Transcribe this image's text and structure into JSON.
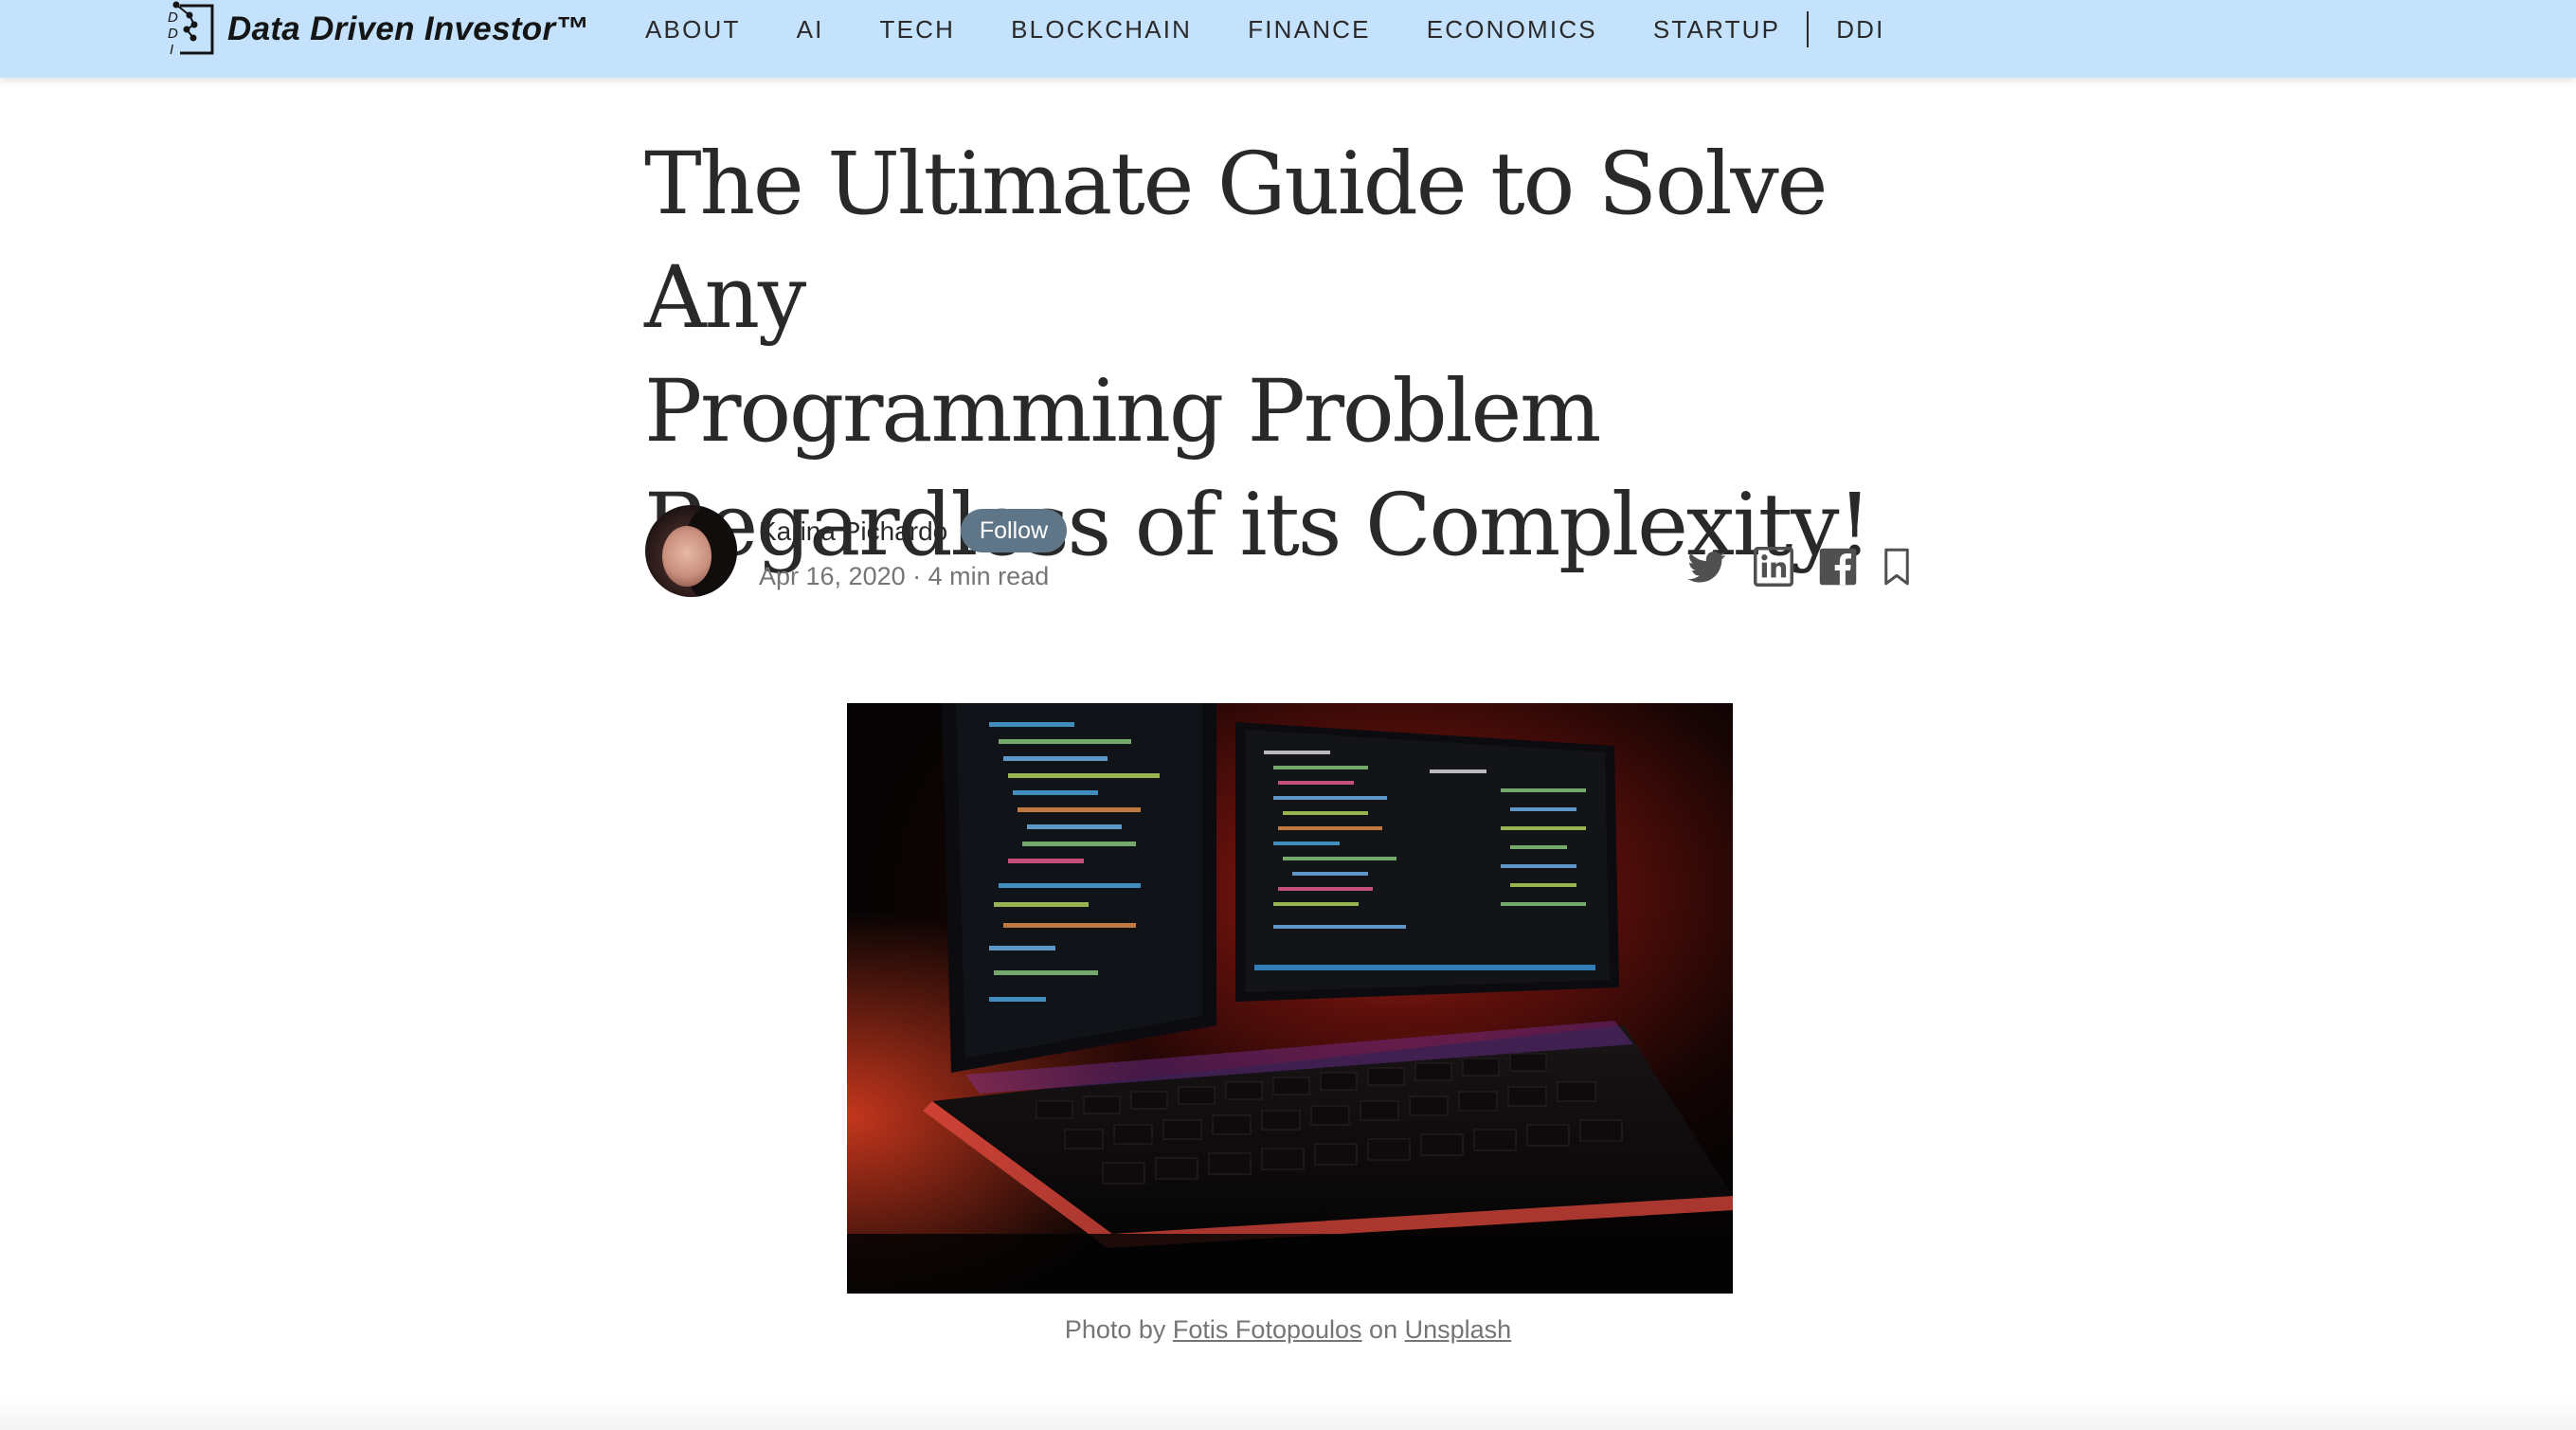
{
  "header": {
    "logo_text": "Data Driven Investor™",
    "logo_mark_letters": [
      "D",
      "D",
      "I"
    ],
    "nav": [
      {
        "label": "ABOUT"
      },
      {
        "label": "AI"
      },
      {
        "label": "TECH"
      },
      {
        "label": "BLOCKCHAIN"
      },
      {
        "label": "FINANCE"
      },
      {
        "label": "ECONOMICS"
      },
      {
        "label": "STARTUP"
      },
      {
        "label": "DDI"
      }
    ],
    "background_color": "#c4e2fb"
  },
  "article": {
    "title_lines": [
      "The Ultimate Guide to Solve Any",
      "Programming Problem",
      "Regardless of its Complexity!"
    ],
    "author": "Karina Pichardo",
    "follow_label": "Follow",
    "date": "Apr 16, 2020",
    "separator": "·",
    "read_time": "4 min read",
    "share_icons": [
      "twitter-icon",
      "linkedin-icon",
      "facebook-icon",
      "bookmark-icon"
    ],
    "accent_color": "#5f7688"
  },
  "image": {
    "caption_prefix": "Photo by",
    "photographer": "Fotis Fotopoulos",
    "caption_mid": "on",
    "source": "Unsplash"
  }
}
